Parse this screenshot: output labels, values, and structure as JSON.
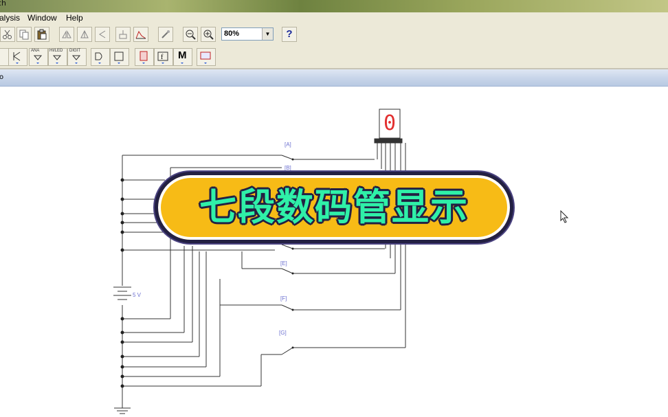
{
  "window": {
    "title_fragment": "ch"
  },
  "menu": {
    "items": [
      "alysis",
      "Window",
      "Help"
    ]
  },
  "toolbar": {
    "zoom_value": "80%",
    "help_label": "?",
    "part_labels": [
      "ANA",
      "HI/LED",
      "DIGIT"
    ],
    "meter_label": "M"
  },
  "subbar": {
    "fragment": "o"
  },
  "circuit": {
    "switch_labels": [
      "[A]",
      "[B]",
      "[E]",
      "[F]",
      "[G]"
    ],
    "battery_label": "5 V",
    "display_digit": "0"
  },
  "banner": {
    "text": "七段数码管显示"
  },
  "colors": {
    "banner_fill": "#f7bb16",
    "banner_text": "#2ff0a8",
    "banner_outline": "#232043"
  }
}
